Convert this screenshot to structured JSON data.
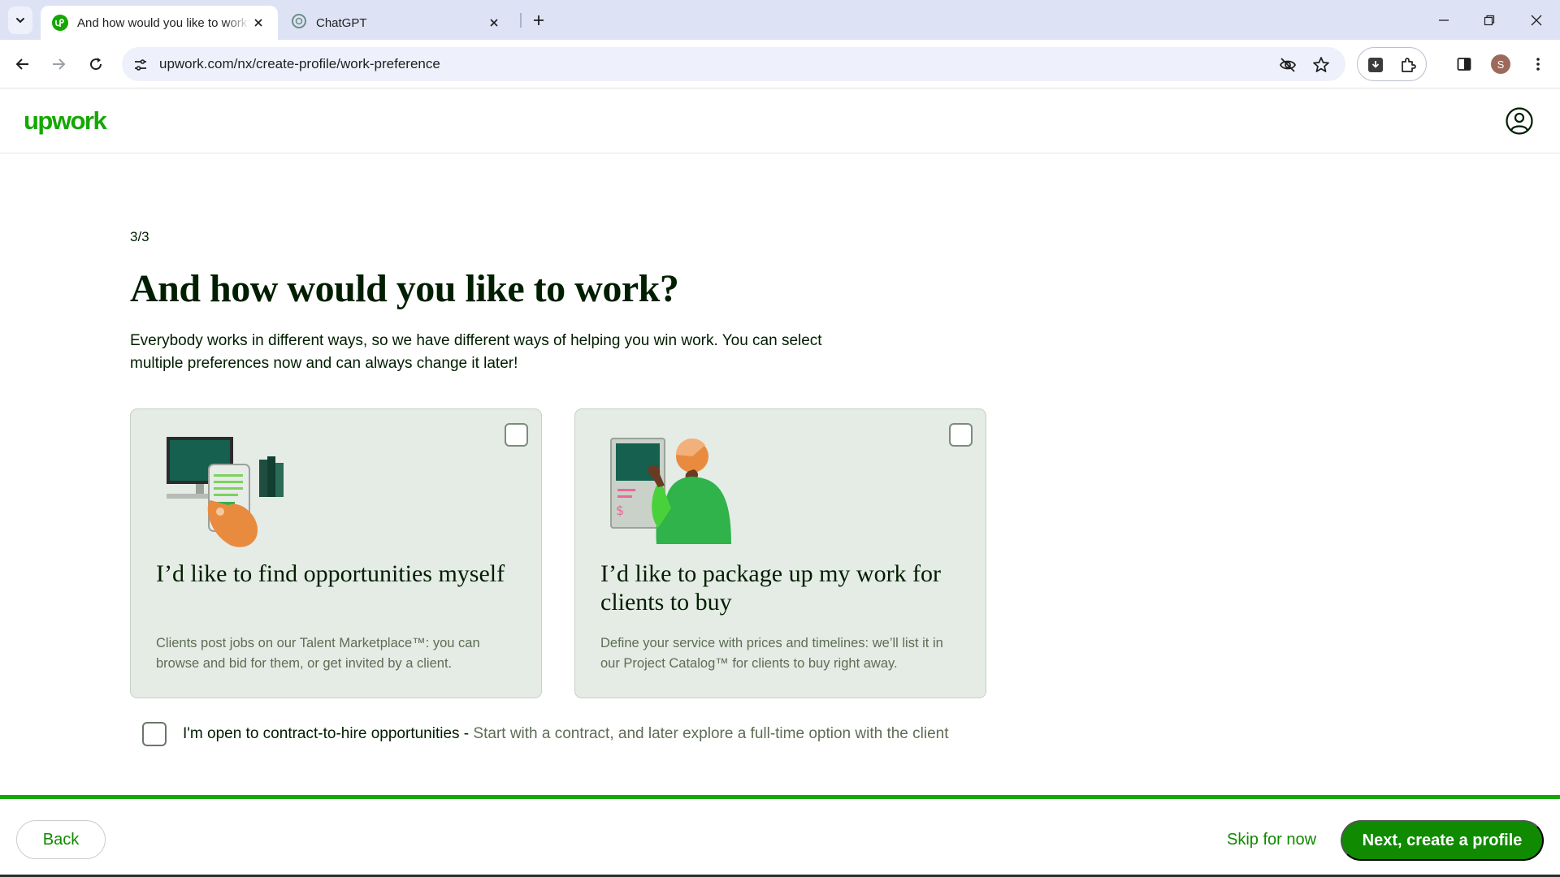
{
  "browser": {
    "tabs": [
      {
        "title": "And how would you like to work?",
        "favicon": "upwork-icon",
        "active": true
      },
      {
        "title": "ChatGPT",
        "favicon": "chatgpt-icon",
        "active": false
      }
    ],
    "url": "upwork.com/nx/create-profile/work-preference",
    "profile_initial": "S"
  },
  "header": {
    "logo": "upwork",
    "brand_color": "#14a800"
  },
  "main": {
    "step": "3/3",
    "title": "And how would you like to work?",
    "subtitle": "Everybody works in different ways, so we have different ways of helping you win work. You can select multiple preferences now and can always change it later!",
    "cards": [
      {
        "title": "I’d like to find opportunities myself",
        "description": "Clients post jobs on our Talent Marketplace™: you can browse and bid for them, or get invited by a client.",
        "checked": false
      },
      {
        "title": "I’d like to package up my work for clients to buy",
        "description": "Define your service with prices and timelines: we’ll list it in our Project Catalog™ for clients to buy right away.",
        "checked": false
      }
    ],
    "contract_to_hire": {
      "label": "I'm open to contract-to-hire opportunities - ",
      "description": "Start with a contract, and later explore a full-time option with the client",
      "checked": false
    }
  },
  "footer": {
    "back_label": "Back",
    "skip_label": "Skip for now",
    "next_label": "Next, create a profile",
    "progress_fraction": 1.0
  }
}
